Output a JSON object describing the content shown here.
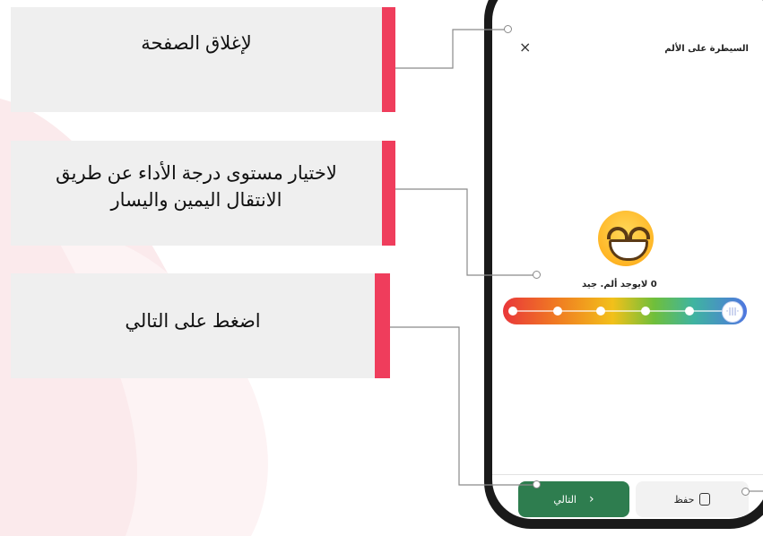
{
  "callouts": {
    "close": "لإغلاق الصفحة",
    "choose_level": "لاختيار مستوى درجة الأداء عن طريق الانتقال اليمين واليسار",
    "press_next": "اضغط على التالي"
  },
  "screen": {
    "title": "السيطرة على الألم",
    "close_glyph": "×",
    "pain_label": "0 لايوجد ألم. جيد",
    "next_label": "التالي",
    "next_chevron": "›",
    "save_label": "حفظ",
    "thumb_glyph": "·|||·"
  },
  "slider": {
    "value": 0
  },
  "colors": {
    "accent_bar": "#ef3d5c",
    "callout_bg": "#efefef",
    "next_button": "#2e7d4f"
  }
}
